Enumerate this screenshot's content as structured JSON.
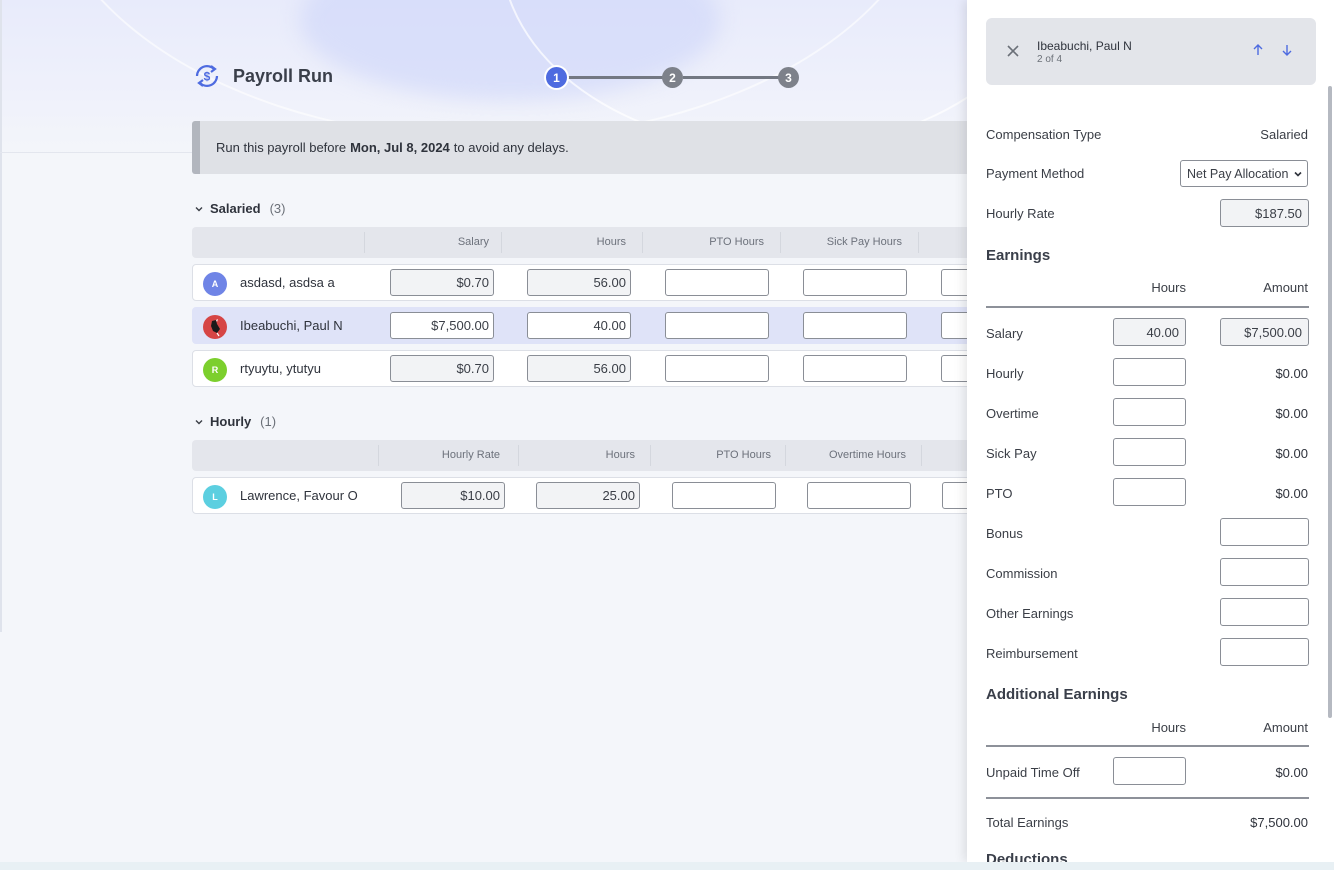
{
  "page": {
    "title": "Payroll Run",
    "steps": [
      "1",
      "2",
      "3"
    ],
    "notice": {
      "prefix": "Run this payroll before",
      "date": "Mon, Jul 8, 2024",
      "suffix": "to avoid any delays."
    }
  },
  "salaried": {
    "title": "Salaried",
    "count": "(3)",
    "columns": [
      "Salary",
      "Hours",
      "PTO Hours",
      "Sick Pay Hours"
    ],
    "rows": [
      {
        "initial": "A",
        "avatar_color": "#6f84e6",
        "name": "asdasd, asdsa a",
        "salary": "$0.70",
        "hours": "56.00",
        "pto": "",
        "sick": "",
        "extra": ""
      },
      {
        "initial": "",
        "avatar_color": "#d64545",
        "name": "Ibeabuchi, Paul N",
        "salary": "$7,500.00",
        "hours": "40.00",
        "pto": "",
        "sick": "",
        "extra": ""
      },
      {
        "initial": "R",
        "avatar_color": "#7ccf2d",
        "name": "rtyuytu, ytutyu",
        "salary": "$0.70",
        "hours": "56.00",
        "pto": "",
        "sick": "",
        "extra": ""
      }
    ]
  },
  "hourly": {
    "title": "Hourly",
    "count": "(1)",
    "columns": [
      "Hourly Rate",
      "Hours",
      "PTO Hours",
      "Overtime Hours"
    ],
    "rows": [
      {
        "initial": "L",
        "avatar_color": "#5ccfe0",
        "name": "Lawrence, Favour O",
        "rate": "$10.00",
        "hours": "25.00",
        "pto": "",
        "overtime": "",
        "extra": ""
      }
    ]
  },
  "panel": {
    "employee_name": "Ibeabuchi, Paul N",
    "position": "2 of 4",
    "compensation_type_label": "Compensation Type",
    "compensation_type_value": "Salaried",
    "payment_method_label": "Payment Method",
    "payment_method_value": "Net Pay Allocation",
    "hourly_rate_label": "Hourly Rate",
    "hourly_rate_value": "$187.50",
    "earnings_heading": "Earnings",
    "hours_col": "Hours",
    "amount_col": "Amount",
    "earnings": [
      {
        "label": "Salary",
        "hours": "40.00",
        "amount": "$7,500.00"
      },
      {
        "label": "Hourly",
        "hours": "",
        "amount": "$0.00"
      },
      {
        "label": "Overtime",
        "hours": "",
        "amount": "$0.00"
      },
      {
        "label": "Sick Pay",
        "hours": "",
        "amount": "$0.00"
      },
      {
        "label": "PTO",
        "hours": "",
        "amount": "$0.00"
      }
    ],
    "amount_only": [
      {
        "label": "Bonus",
        "amount": ""
      },
      {
        "label": "Commission",
        "amount": ""
      },
      {
        "label": "Other Earnings",
        "amount": ""
      },
      {
        "label": "Reimbursement",
        "amount": ""
      }
    ],
    "additional_heading": "Additional Earnings",
    "unpaid_label": "Unpaid Time Off",
    "unpaid_hours": "",
    "unpaid_amount": "$0.00",
    "total_label": "Total Earnings",
    "total_value": "$7,500.00",
    "deductions_heading": "Deductions"
  },
  "colors": {
    "accent": "#4e6be0",
    "selected_row": "#dfe3f8"
  }
}
